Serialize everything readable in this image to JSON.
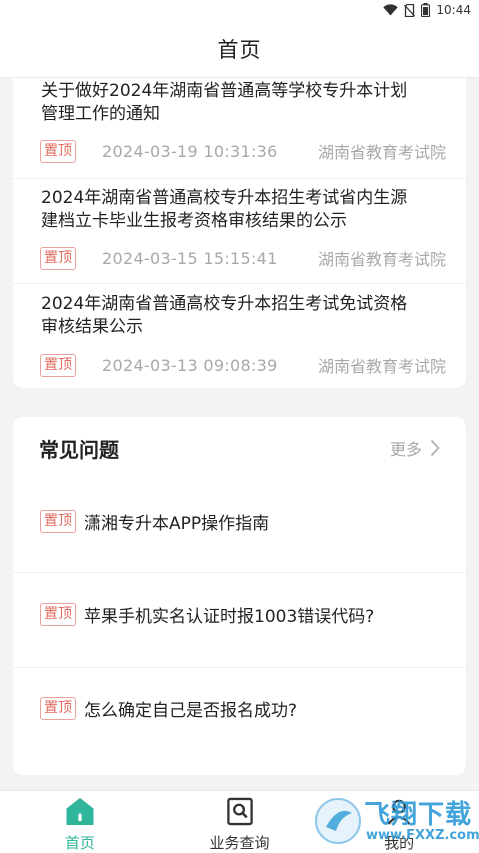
{
  "status_bar": {
    "time": "10:44"
  },
  "nav": {
    "title": "首页"
  },
  "news": [
    {
      "title_line1": "关于做好2024年湖南省普通高等学校专升本计划",
      "title_line2": "管理工作的通知",
      "tag": "置顶",
      "date": "2024-03-19 10:31:36",
      "source": "湖南省教育考试院"
    },
    {
      "title_line1": "2024年湖南省普通高校专升本招生考试省内生源",
      "title_line2": "建档立卡毕业生报考资格审核结果的公示",
      "tag": "置顶",
      "date": "2024-03-15 15:15:41",
      "source": "湖南省教育考试院"
    },
    {
      "title_line1": "2024年湖南省普通高校专升本招生考试免试资格",
      "title_line2": "审核结果公示",
      "tag": "置顶",
      "date": "2024-03-13 09:08:39",
      "source": "湖南省教育考试院"
    }
  ],
  "faq": {
    "title": "常见问题",
    "more_label": "更多",
    "items": [
      {
        "tag": "置顶",
        "text": "潇湘专升本APP操作指南"
      },
      {
        "tag": "置顶",
        "text": "苹果手机实名认证时报1003错误代码?"
      },
      {
        "tag": "置顶",
        "text": "怎么确定自己是否报名成功?"
      }
    ]
  },
  "tabs": [
    {
      "label": "首页",
      "icon": "home-icon",
      "active": true
    },
    {
      "label": "业务查询",
      "icon": "search-doc-icon",
      "active": false
    },
    {
      "label": "我的",
      "icon": "profile-icon",
      "active": false
    }
  ],
  "watermark": {
    "text": "飞翔下载",
    "url": "www.FXXZ.com"
  },
  "colors": {
    "accent": "#2fb59a",
    "tag": "#e06a5e",
    "muted": "#a8a8a8",
    "background": "#f3f3f5"
  }
}
